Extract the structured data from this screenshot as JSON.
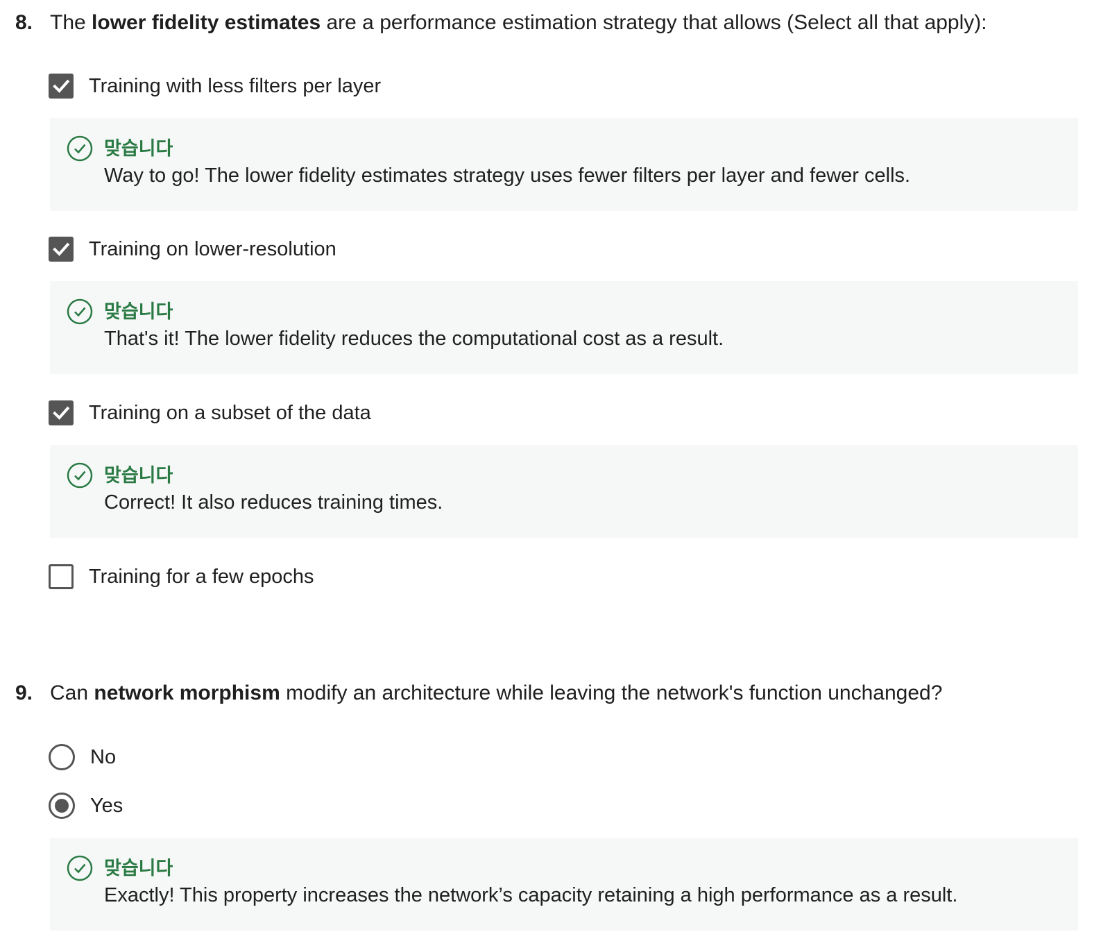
{
  "accent_color": "#2a7a44",
  "feedback_bg": "#f6f8f7",
  "questions": [
    {
      "number": "8.",
      "prefix": "The ",
      "bold": "lower fidelity estimates",
      "suffix": " are a performance estimation strategy that allows (Select all that apply):",
      "options": [
        {
          "label": "Training with less filters per layer",
          "checked": true,
          "feedback_title": "맞습니다",
          "feedback_text": "Way to go! The lower fidelity estimates strategy uses fewer filters per layer and fewer cells."
        },
        {
          "label": "Training on lower-resolution",
          "checked": true,
          "feedback_title": "맞습니다",
          "feedback_text": "That's it! The lower fidelity reduces the computational cost as a result."
        },
        {
          "label": "Training on a subset of the data",
          "checked": true,
          "feedback_title": "맞습니다",
          "feedback_text": "Correct! It also reduces training times."
        },
        {
          "label": "Training for a few epochs",
          "checked": false
        }
      ]
    },
    {
      "number": "9.",
      "prefix": "Can ",
      "bold": "network morphism",
      "suffix": " modify an architecture while leaving the network's function unchanged?",
      "options": [
        {
          "label": "No",
          "selected": false
        },
        {
          "label": "Yes",
          "selected": true,
          "feedback_title": "맞습니다",
          "feedback_text": "Exactly! This property increases the network’s capacity retaining a high performance as a result."
        }
      ]
    }
  ]
}
